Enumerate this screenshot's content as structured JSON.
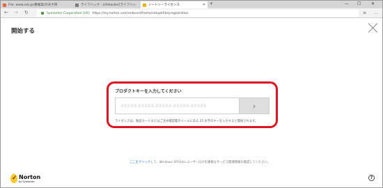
{
  "browser": {
    "tabs": [
      {
        "label": "File: www.ssk.jp(重複案)のあや目",
        "color": "#e36b3d"
      },
      {
        "label": "ライフハック - Lifehacker[ライフハッ",
        "color": "#7d7d7d"
      },
      {
        "label": "ノートン・ライセンス",
        "color": "#f2b200"
      }
    ],
    "window_buttons": {
      "minimize": "—",
      "restore": "☐",
      "close": "✕"
    },
    "new_tab": "+",
    "cert_name": "Symantec Corporation [US]",
    "url": "https://my.norton.com/onboard/home/setupkf/keyregistration",
    "icons": [
      "back-icon",
      "forward-icon",
      "refresh-icon",
      "reading-view-icon",
      "favorite-icon",
      "hub-icon",
      "note-icon",
      "share-icon",
      "more-icon"
    ]
  },
  "page": {
    "title": "開始する",
    "prompt": "プロダクトキーを入力してください",
    "key_placeholder": "XXXXX-XXXXX-XXXXX-XXXXX-XXXXX",
    "submit_glyph": "›",
    "help_text": "ライセンスは、製品カードまたはご注文確認電子メールにある 25 文字のキーを入力すると開始されます。",
    "footer_link": "ここをクリック",
    "footer_text": "して、Windows XP/Vista ユーザー向けの重要なサービス関連情報を確認してください。",
    "help_button": "?"
  },
  "logo": {
    "name": "Norton",
    "subtitle": "by Symantec",
    "mark": "✓"
  },
  "colors": {
    "highlight": "#e0141e",
    "link": "#1a73c8",
    "cert": "#2e7d32",
    "logo_yellow": "#ffc72c"
  }
}
